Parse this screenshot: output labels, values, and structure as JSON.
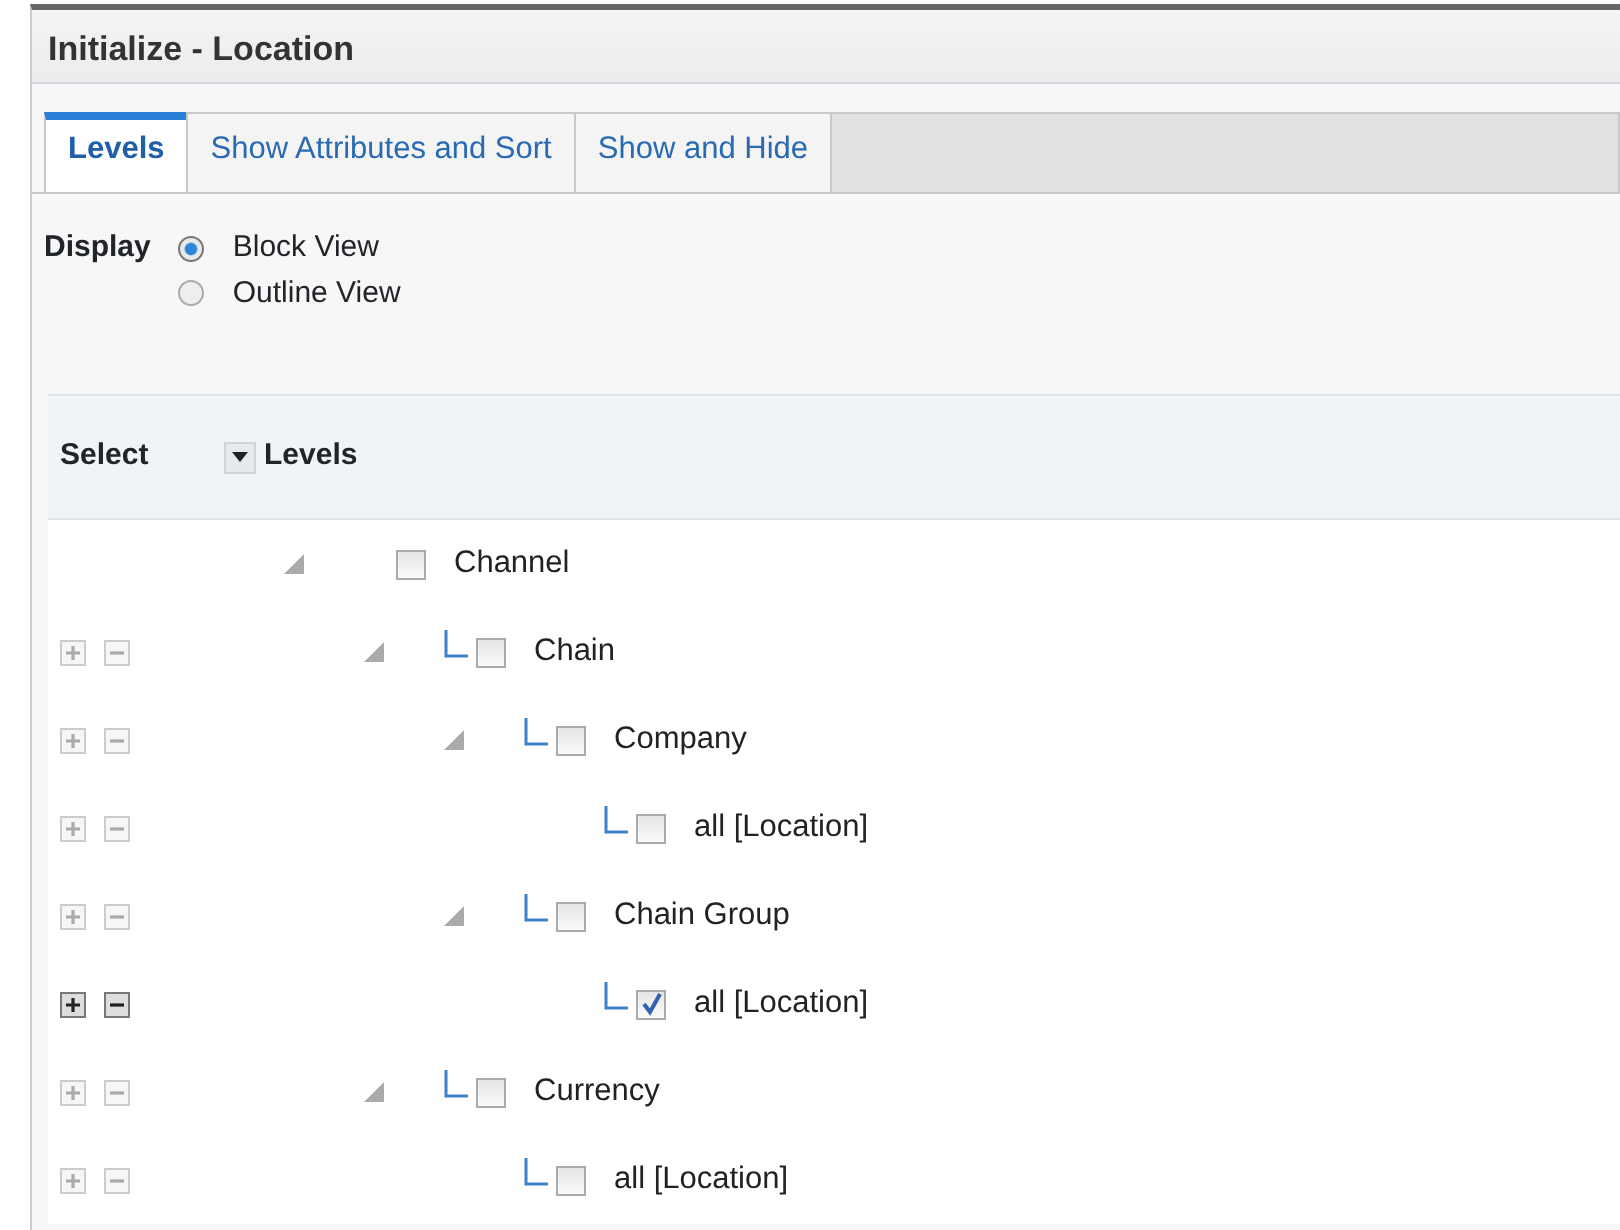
{
  "dialog": {
    "title": "Initialize - Location"
  },
  "tabs": [
    {
      "label": "Levels",
      "selected": true
    },
    {
      "label": "Show Attributes and Sort",
      "selected": false
    },
    {
      "label": "Show and Hide",
      "selected": false
    }
  ],
  "display": {
    "label": "Display",
    "options": [
      {
        "label": "Block View",
        "selected": true
      },
      {
        "label": "Outline View",
        "selected": false
      }
    ]
  },
  "table": {
    "columns": [
      "Select",
      "Levels"
    ],
    "tree": [
      {
        "label": "Channel",
        "checked": false,
        "expanded": true,
        "children": [
          {
            "label": "Chain",
            "checked": false,
            "expanded": true,
            "buttons_disabled": true,
            "children": [
              {
                "label": "Company",
                "checked": false,
                "expanded": true,
                "buttons_disabled": true,
                "children": [
                  {
                    "label": "all [Location]",
                    "checked": false,
                    "buttons_disabled": true
                  }
                ]
              },
              {
                "label": "Chain Group",
                "checked": false,
                "expanded": true,
                "buttons_disabled": true,
                "children": [
                  {
                    "label": "all [Location]",
                    "checked": true,
                    "buttons_disabled": false
                  }
                ]
              }
            ]
          },
          {
            "label": "Currency",
            "checked": false,
            "expanded": true,
            "buttons_disabled": true,
            "children": [
              {
                "label": "all [Location]",
                "checked": false,
                "buttons_disabled": true
              }
            ]
          }
        ]
      }
    ]
  }
}
